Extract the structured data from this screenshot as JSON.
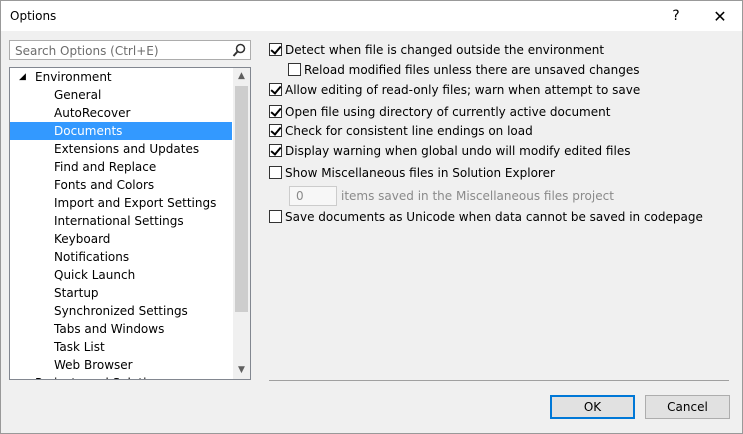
{
  "window": {
    "title": "Options",
    "help_glyph": "?",
    "close_glyph": "✕"
  },
  "search": {
    "placeholder": "Search Options (Ctrl+E)"
  },
  "tree": {
    "parent": {
      "label": "Environment",
      "expander": "◢"
    },
    "items": [
      {
        "label": "General"
      },
      {
        "label": "AutoRecover"
      },
      {
        "label": "Documents",
        "selected": true
      },
      {
        "label": "Extensions and Updates"
      },
      {
        "label": "Find and Replace"
      },
      {
        "label": "Fonts and Colors"
      },
      {
        "label": "Import and Export Settings"
      },
      {
        "label": "International Settings"
      },
      {
        "label": "Keyboard"
      },
      {
        "label": "Notifications"
      },
      {
        "label": "Quick Launch"
      },
      {
        "label": "Startup"
      },
      {
        "label": "Synchronized Settings"
      },
      {
        "label": "Tabs and Windows"
      },
      {
        "label": "Task List"
      },
      {
        "label": "Web Browser"
      }
    ],
    "next_partial": {
      "label": "Projects and Solutions"
    }
  },
  "options": [
    {
      "label": "Detect when file is changed outside the environment",
      "checked": true
    },
    {
      "label": "Reload modified files unless there are unsaved changes",
      "checked": false
    },
    {
      "label": "Allow editing of read-only files; warn when attempt to save",
      "checked": true
    },
    {
      "label": "Open file using directory of currently active document",
      "checked": true
    },
    {
      "label": "Check for consistent line endings on load",
      "checked": true
    },
    {
      "label": "Display warning when global undo will modify edited files",
      "checked": true
    },
    {
      "label": "Show Miscellaneous files in Solution Explorer",
      "checked": false
    },
    {
      "label": "Save documents as Unicode when data cannot be saved in codepage",
      "checked": false
    }
  ],
  "misc_items": {
    "value": "0",
    "label": "items saved in the Miscellaneous files project"
  },
  "buttons": {
    "ok": "OK",
    "cancel": "Cancel"
  },
  "colors": {
    "selection": "#3399ff",
    "default_button_border": "#0078d7"
  }
}
